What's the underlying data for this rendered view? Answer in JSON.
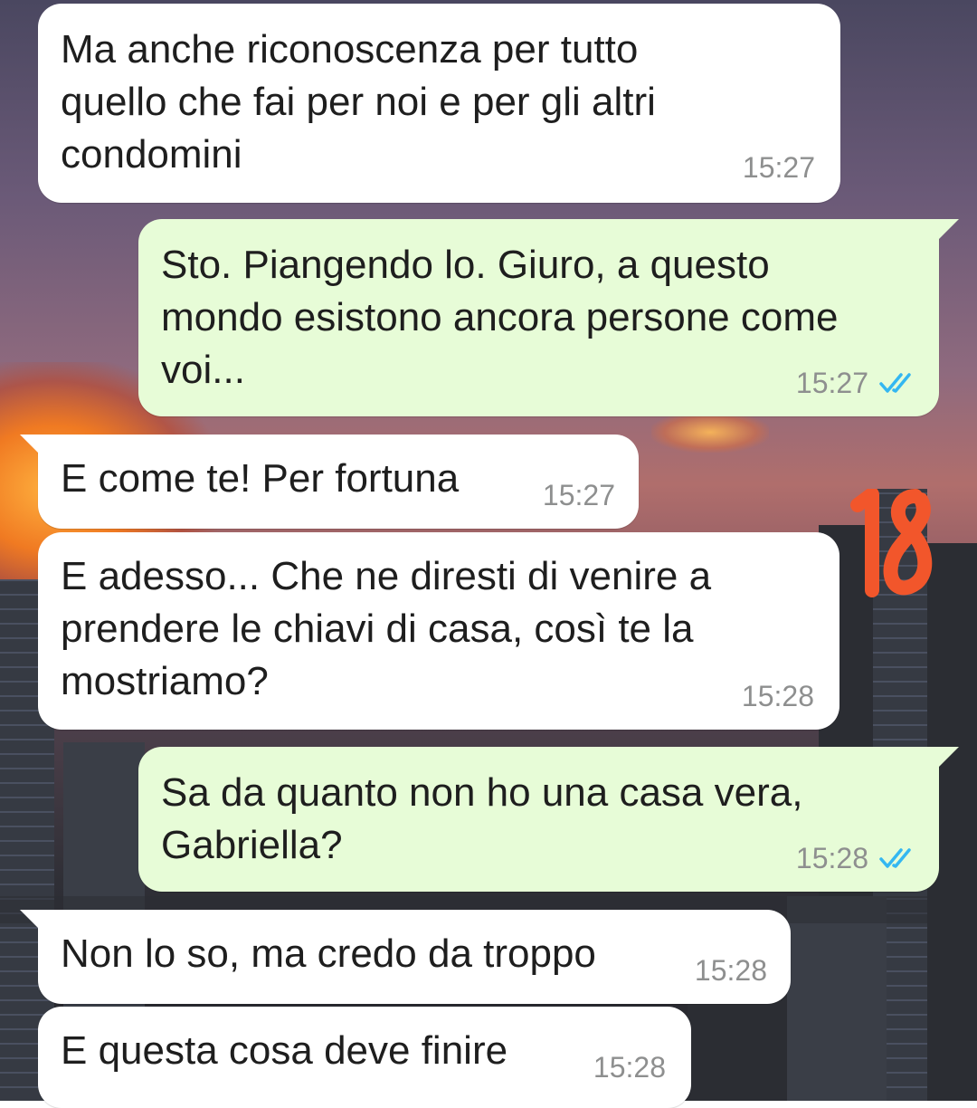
{
  "chat": {
    "accent_read_ticks": "#34b7f1",
    "sticker_text": "18",
    "messages": [
      {
        "direction": "incoming",
        "text": "Ma anche riconoscenza per tutto\nquello che fai per noi e per gli altri\ncondomini",
        "time": "15:27"
      },
      {
        "direction": "outgoing",
        "text": "Sto. Piangendo lo. Giuro, a questo\nmondo esistono ancora persone come\nvoi...",
        "time": "15:27",
        "status": "read"
      },
      {
        "direction": "incoming",
        "text": "E come te! Per fortuna",
        "time": "15:27"
      },
      {
        "direction": "incoming",
        "text": "E adesso... Che ne diresti di venire a\nprendere le chiavi di casa, così te la\nmostriamo?",
        "time": "15:28"
      },
      {
        "direction": "outgoing",
        "text": "Sa da quanto non ho una casa vera,\nGabriella?",
        "time": "15:28",
        "status": "read"
      },
      {
        "direction": "incoming",
        "text": "Non lo so, ma credo da troppo",
        "time": "15:28"
      },
      {
        "direction": "incoming",
        "text": "E questa cosa deve finire",
        "time": "15:28"
      }
    ]
  }
}
